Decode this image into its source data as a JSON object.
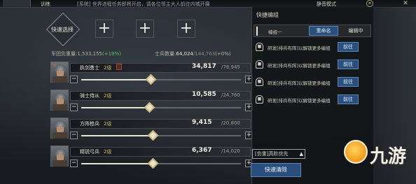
{
  "topbar": {
    "title": "训练",
    "bulletin": "[系统] 世界进程任务即将开启，请各位领主大人前往内城开展",
    "mode": "静音模式",
    "coin_icon": "coin-icon",
    "close_icon": "close-icon"
  },
  "quick_select": {
    "label": "快速选择"
  },
  "slots": [
    "+",
    "+",
    "+"
  ],
  "stats": {
    "army_load_label": "军团负重量:",
    "army_load_value": "1,533,155",
    "army_load_bonus": "(+19%)",
    "soldier_label": "士兵数量:",
    "soldier_value": "64,024",
    "soldier_cap": "/144,763",
    "soldier_bonus": "(+0%)"
  },
  "troops": [
    {
      "name": "执剑勇士",
      "level": "2级",
      "count": "34,817",
      "max": "/78,945",
      "fill": 0.44
    },
    {
      "name": "骑士侍从",
      "level": "2级",
      "count": "10,585",
      "max": "/24,760",
      "fill": 0.43
    },
    {
      "name": "方阵枪兵",
      "level": "2级",
      "count": "9,415",
      "max": "/20,800",
      "fill": 0.45
    },
    {
      "name": "精锐弓兵",
      "level": "2级",
      "count": "6,367",
      "max": "/14,020",
      "fill": 0.45
    }
  ],
  "panel": {
    "title": "快捷编组",
    "rows": [
      {
        "text": "编组一",
        "rename": "重命名",
        "action": "编辑中",
        "selected": true
      },
      {
        "text": "研发[排兵布阵]以解锁更多编组",
        "action": "前往"
      },
      {
        "text": "研发[排兵布阵]以解锁更多编组",
        "action": "前往"
      },
      {
        "text": "研发[排兵布阵]以解锁更多编组",
        "action": "前往"
      },
      {
        "text": "研发[排兵布阵]以解锁更多编组",
        "action": "前往"
      }
    ],
    "dropdown": "[负重]高阶优先",
    "clear_button": "快速清除"
  },
  "watermark": {
    "text": "九游"
  },
  "colors": {
    "accent_blue": "#2b4f7c",
    "knob_gold": "#cdb87c",
    "bonus_green": "#5cc36a"
  }
}
